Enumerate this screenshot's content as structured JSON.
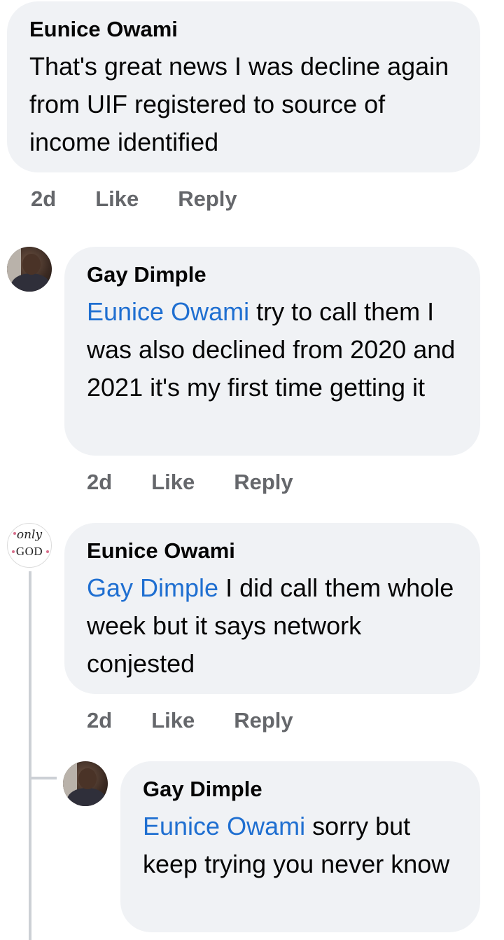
{
  "comments": [
    {
      "author": "Eunice Owami",
      "mention": "",
      "text": "That's great news I was decline again from UIF registered to source of income identified",
      "time": "2d",
      "like": "Like",
      "reply": "Reply"
    },
    {
      "author": "Gay Dimple",
      "mention": "Eunice Owami",
      "text": " try to call them I was also declined from 2020 and 2021 it's my first time getting it",
      "time": "2d",
      "like": "Like",
      "reply": "Reply",
      "avatar_icon": "profile-photo"
    },
    {
      "author": "Eunice Owami",
      "mention": "Gay Dimple",
      "text": "  I did call them whole week but it says network conjested",
      "time": "2d",
      "like": "Like",
      "reply": "Reply",
      "avatar_icon": "only-god-avatar",
      "avatar_text_top": "only",
      "avatar_text_bottom": "GOD"
    },
    {
      "author": "Gay Dimple",
      "mention": "Eunice Owami",
      "text": " sorry but keep trying you never know",
      "avatar_icon": "profile-photo"
    }
  ],
  "colors": {
    "bubble": "#f0f2f5",
    "mention": "#1f6fd1",
    "meta": "#65676b"
  }
}
